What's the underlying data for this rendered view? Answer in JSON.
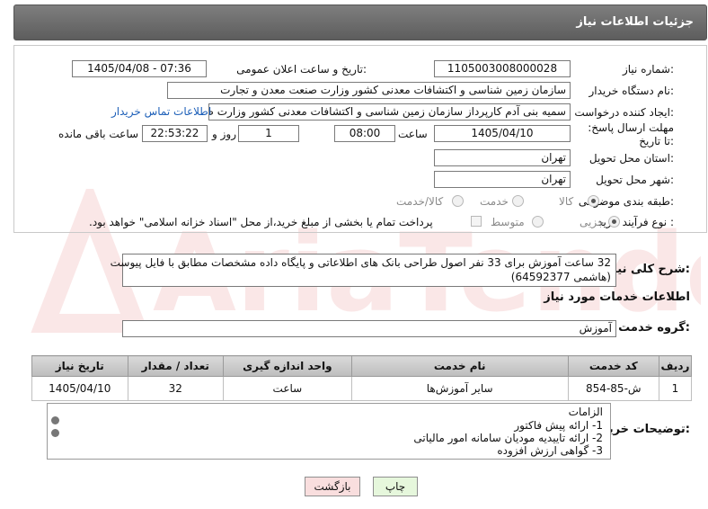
{
  "header": {
    "title": "جزئیات اطلاعات نیاز"
  },
  "form": {
    "need_number_label": "شماره نیاز:",
    "need_number": "1105003008000028",
    "announce_label": "تاریخ و ساعت اعلان عمومی:",
    "announce_value": "1405/04/08 - 07:36",
    "buyer_org_label": "نام دستگاه خریدار:",
    "buyer_org": "سازمان زمین شناسی و اکتشافات معدنی کشور وزارت صنعت معدن و تجارت",
    "creator_label": "ایجاد کننده درخواست:",
    "creator": "سمیه بنی آدم کارپرداز سازمان زمین شناسی و اکتشافات معدنی کشور وزارت ص",
    "contact_link": "اطلاعات تماس خریدار",
    "deadline_label": "مهلت ارسال پاسخ: تا تاریخ:",
    "deadline_date": "1405/04/10",
    "time_label": "ساعت",
    "deadline_time": "08:00",
    "days_value": "1",
    "days_label": "روز و",
    "remaining_time": "22:53:22",
    "remaining_label": "ساعت باقی مانده",
    "province_label": "استان محل تحویل:",
    "province": "تهران",
    "city_label": "شهر محل تحویل:",
    "city": "تهران",
    "category_label": "طبقه بندی موضوعی:",
    "category_options": [
      "کالا",
      "خدمت",
      "کالا/خدمت"
    ],
    "process_label": "نوع فرآیند خرید :",
    "process_options": [
      "جزیی",
      "متوسط"
    ],
    "payment_note": "پرداخت تمام یا بخشی از مبلغ خرید،از محل \"اسناد خزانه اسلامی\" خواهد بود."
  },
  "description": {
    "label": "شرح کلی نیاز:",
    "line1": "32 ساعت آموزش برای 33 نفر اصول طراحی بانک های اطلاعاتی و پایگاه داده مشخصات مطابق با فایل پیوست",
    "line2": "(هاشمی 64592377)"
  },
  "services": {
    "section_title": "اطلاعات خدمات مورد نیاز",
    "group_label": "گروه خدمت:",
    "group_value": "آموزش",
    "columns": [
      "ردیف",
      "کد خدمت",
      "نام خدمت",
      "واحد اندازه گیری",
      "تعداد / مقدار",
      "تاریخ نیاز"
    ],
    "rows": [
      {
        "index": "1",
        "code": "ش-85-854",
        "name": "سایر آموزش‌ها",
        "unit": "ساعت",
        "qty": "32",
        "date": "1405/04/10"
      }
    ]
  },
  "buyer_notes": {
    "label": "توضیحات خریدار:",
    "lines": [
      "الزامات",
      "1-    ارائه پیش فاکتور",
      "2-    ارائه تاییدیه مودیان سامانه امور مالیاتی",
      "3-    گواهی ارزش افزوده"
    ]
  },
  "buttons": {
    "print": "چاپ",
    "back": "بازگشت"
  },
  "watermark": "AriaTender.net",
  "colors": {
    "title_bar": "#6b6b6b",
    "link": "#1d5fb8",
    "print_btn": "#e6f7dc",
    "back_btn": "#f9dede"
  }
}
